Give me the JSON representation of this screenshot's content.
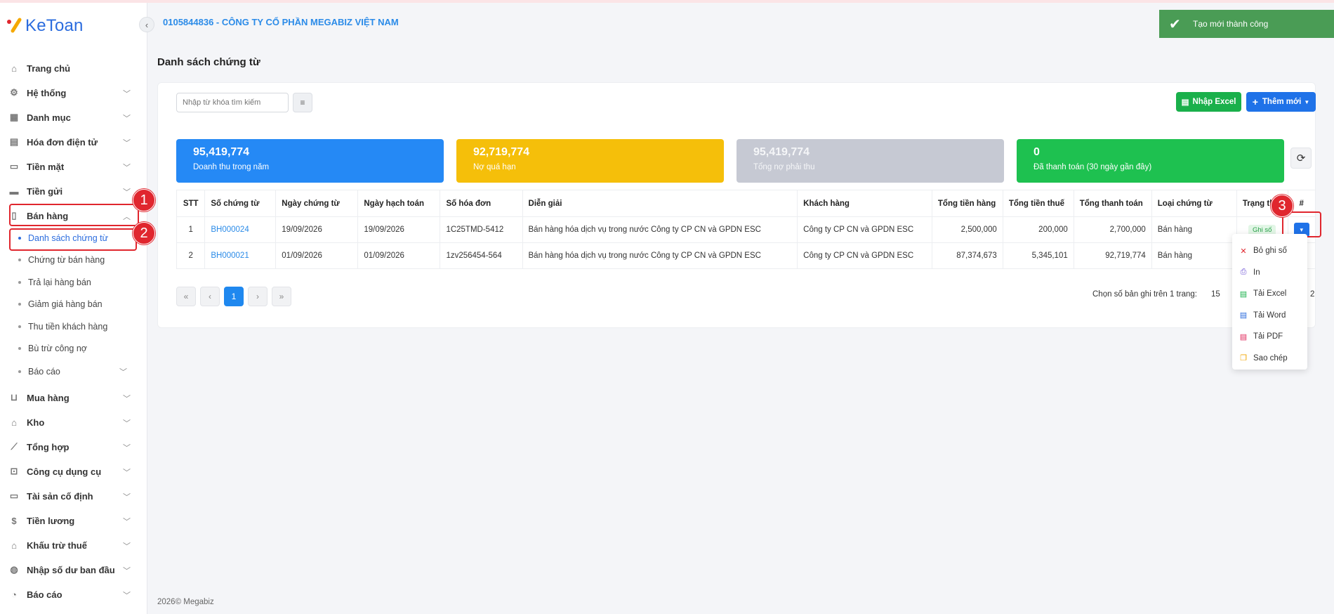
{
  "app": {
    "logo_text": "KeToan"
  },
  "header": {
    "company": "0105844836 - CÔNG TY CỔ PHẦN MEGABIZ VIỆT NAM"
  },
  "toast": {
    "message": "Tạo mới thành công"
  },
  "sidebar": {
    "items": [
      {
        "label": "Trang chủ",
        "icon": "home-icon"
      },
      {
        "label": "Hệ thống",
        "icon": "gear-icon"
      },
      {
        "label": "Danh mục",
        "icon": "grid-icon"
      },
      {
        "label": "Hóa đơn điện tử",
        "icon": "invoice-icon"
      },
      {
        "label": "Tiền mặt",
        "icon": "cash-icon"
      },
      {
        "label": "Tiền gửi",
        "icon": "card-icon"
      },
      {
        "label": "Bán hàng",
        "icon": "sale-icon"
      },
      {
        "label": "Mua hàng",
        "icon": "cart-icon"
      },
      {
        "label": "Kho",
        "icon": "warehouse-icon"
      },
      {
        "label": "Tổng hợp",
        "icon": "chart-icon"
      },
      {
        "label": "Công cụ dụng cụ",
        "icon": "tools-icon"
      },
      {
        "label": "Tài sản cố định",
        "icon": "car-icon"
      },
      {
        "label": "Tiền lương",
        "icon": "salary-icon"
      },
      {
        "label": "Khấu trừ thuế",
        "icon": "bank-icon"
      },
      {
        "label": "Nhập số dư ban đầu",
        "icon": "balance-icon"
      },
      {
        "label": "Báo cáo",
        "icon": "report-icon"
      }
    ],
    "sub_items": [
      {
        "label": "Danh sách chứng từ"
      },
      {
        "label": "Chứng từ bán hàng"
      },
      {
        "label": "Trả lại hàng bán"
      },
      {
        "label": "Giảm giá hàng bán"
      },
      {
        "label": "Thu tiền khách hàng"
      },
      {
        "label": "Bù trừ công nợ"
      },
      {
        "label": "Báo cáo"
      }
    ]
  },
  "annotations": [
    "1",
    "2",
    "3"
  ],
  "page": {
    "title": "Danh sách chứng từ"
  },
  "toolbar": {
    "search_placeholder": "Nhập từ khóa tìm kiếm",
    "import_excel": "Nhập Excel",
    "add_new": "Thêm mới"
  },
  "stats": [
    {
      "value": "95,419,774",
      "label": "Doanh thu trong năm",
      "color": "#2589f5"
    },
    {
      "value": "92,719,774",
      "label": "Nợ quá hạn",
      "color": "#f5bf0a"
    },
    {
      "value": "95,419,774",
      "label": "Tổng nợ phải thu",
      "color": "#c6c9d3"
    },
    {
      "value": "0",
      "label": "Đã thanh toán (30 ngày gần đây)",
      "color": "#1ec150"
    }
  ],
  "table": {
    "headers": [
      "STT",
      "Số chứng từ",
      "Ngày chứng từ",
      "Ngày hạch toán",
      "Số hóa đơn",
      "Diễn giải",
      "Khách hàng",
      "Tổng tiền hàng",
      "Tổng tiền thuế",
      "Tổng thanh toán",
      "Loại chứng từ",
      "Trạng thái",
      "#"
    ],
    "rows": [
      [
        "1",
        "BH000024",
        "19/09/2026",
        "19/09/2026",
        "1C25TMD-5412",
        "Bán hàng hóa dịch vụ trong nước Công ty CP CN và GPDN ESC",
        "Công ty CP CN và GPDN ESC",
        "2,500,000",
        "200,000",
        "2,700,000",
        "Bán hàng",
        "Ghi số"
      ],
      [
        "2",
        "BH000021",
        "01/09/2026",
        "01/09/2026",
        "1zv256454-564",
        "Bán hàng hóa dịch vụ trong nước Công ty CP CN và GPDN ESC",
        "Công ty CP CN và GPDN ESC",
        "87,374,673",
        "5,345,101",
        "92,719,774",
        "Bán hàng",
        ""
      ]
    ]
  },
  "pagination": {
    "current": "1",
    "per_page_label": "Chọn số bản ghi trên 1 trang:",
    "per_page": "15",
    "trail": "2"
  },
  "menu": [
    {
      "label": "Bỏ ghi số",
      "icon": "close-icon",
      "color": "#e0262e"
    },
    {
      "label": "In",
      "icon": "printer-icon",
      "color": "#6a4fd6"
    },
    {
      "label": "Tải Excel",
      "icon": "excel-file-icon",
      "color": "#1ab04b"
    },
    {
      "label": "Tải Word",
      "icon": "word-file-icon",
      "color": "#2b6cde"
    },
    {
      "label": "Tải PDF",
      "icon": "pdf-file-icon",
      "color": "#e0265a"
    },
    {
      "label": "Sao chép",
      "icon": "copy-icon",
      "color": "#f0a500"
    }
  ],
  "footer": {
    "text": "2026© Megabiz"
  }
}
